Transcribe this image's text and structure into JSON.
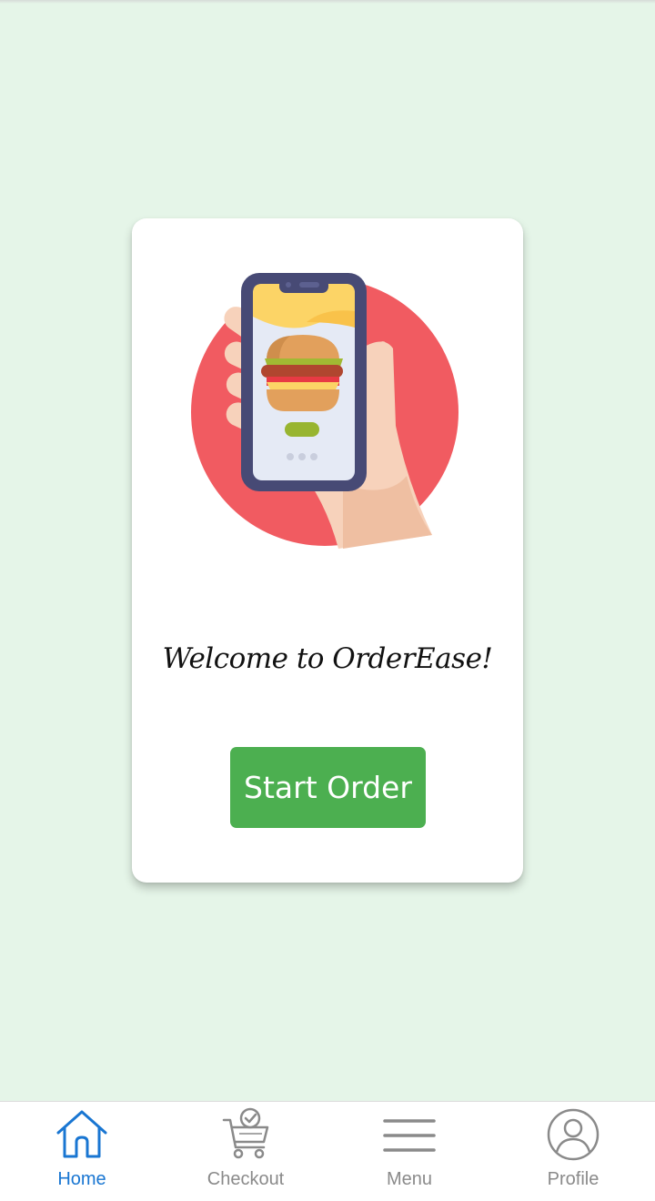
{
  "welcome": {
    "title": "Welcome to OrderEase!",
    "button_label": "Start Order",
    "illustration_icon": "phone-burger-order-icon"
  },
  "nav": {
    "active_color": "#1976d2",
    "inactive_color": "#8a8a8a",
    "items": [
      {
        "label": "Home",
        "icon": "home-icon",
        "active": true
      },
      {
        "label": "Checkout",
        "icon": "cart-check-icon",
        "active": false
      },
      {
        "label": "Menu",
        "icon": "menu-icon",
        "active": false
      },
      {
        "label": "Profile",
        "icon": "profile-icon",
        "active": false
      }
    ]
  },
  "colors": {
    "background": "#e5f5e8",
    "button": "#4caf50",
    "card": "#ffffff"
  }
}
